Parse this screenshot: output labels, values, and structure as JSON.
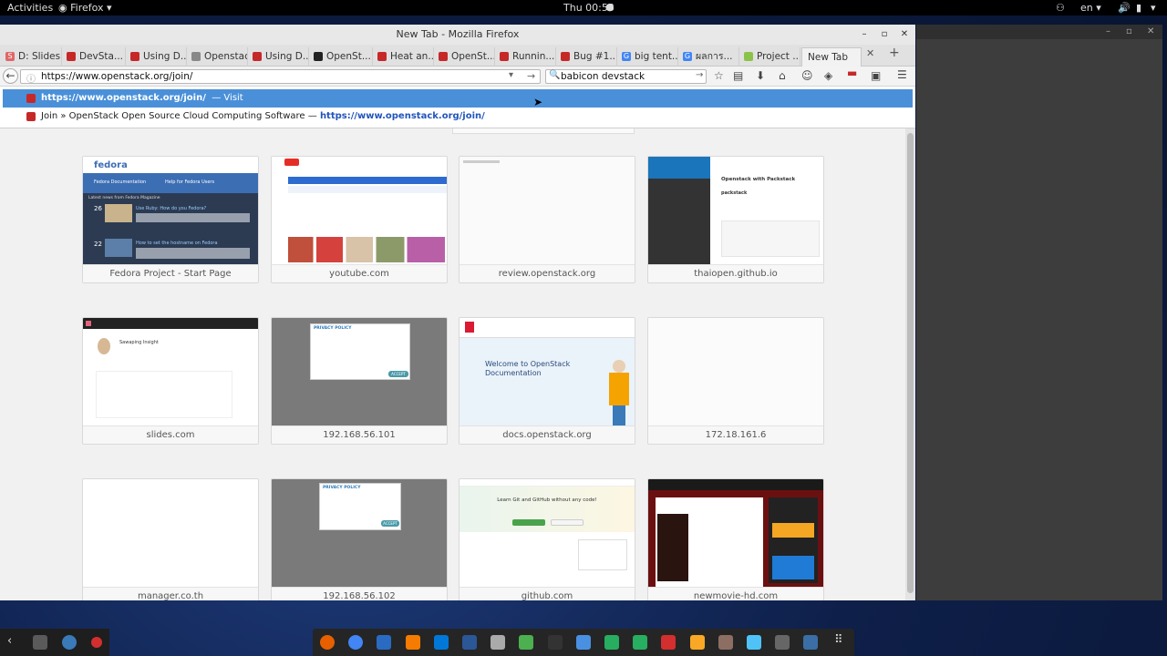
{
  "topbar": {
    "activities": "Activities",
    "app": "Firefox",
    "clock": "Thu 00:53",
    "lang": "en"
  },
  "window": {
    "title": "New Tab - Mozilla Firefox"
  },
  "tabs": [
    {
      "label": "D: Slides",
      "fav": "S",
      "color": "#e06767"
    },
    {
      "label": "DevSta...",
      "fav": "",
      "color": "#c62828"
    },
    {
      "label": "Using D...",
      "fav": "",
      "color": "#c62828"
    },
    {
      "label": "Openstack ...",
      "fav": "",
      "color": "#888888"
    },
    {
      "label": "Using D...",
      "fav": "",
      "color": "#c62828"
    },
    {
      "label": "OpenSt...",
      "fav": "",
      "color": "#222222"
    },
    {
      "label": "Heat an...",
      "fav": "",
      "color": "#c62828"
    },
    {
      "label": "OpenSt...",
      "fav": "",
      "color": "#c62828"
    },
    {
      "label": "Runnin...",
      "fav": "",
      "color": "#c62828"
    },
    {
      "label": "Bug #1...",
      "fav": "",
      "color": "#c62828"
    },
    {
      "label": "big tent...",
      "fav": "G",
      "color": "#4285f4"
    },
    {
      "label": "ผลการ...",
      "fav": "G",
      "color": "#4285f4"
    },
    {
      "label": "Project ...",
      "fav": "",
      "color": "#8bc34a"
    },
    {
      "label": "New Tab",
      "fav": "",
      "color": ""
    }
  ],
  "navbar": {
    "url": "https://www.openstack.org/join/",
    "search": "babicon devstack"
  },
  "popup": {
    "row1_url": "https://www.openstack.org/join/",
    "row1_action": "— Visit",
    "row2_title": "Join » OpenStack Open Source Cloud Computing Software",
    "row2_sep": "—",
    "row2_url": "https://www.openstack.org/join/"
  },
  "tiles": [
    {
      "caption": "Fedora Project - Start Page"
    },
    {
      "caption": "youtube.com"
    },
    {
      "caption": "review.openstack.org"
    },
    {
      "caption": "thaiopen.github.io"
    },
    {
      "caption": "slides.com"
    },
    {
      "caption": "192.168.56.101"
    },
    {
      "caption": "docs.openstack.org"
    },
    {
      "caption": "172.18.161.6"
    },
    {
      "caption": "manager.co.th"
    },
    {
      "caption": "192.168.56.102"
    },
    {
      "caption": "github.com"
    },
    {
      "caption": "newmovie-hd.com"
    }
  ],
  "thumbs": {
    "fedora": {
      "logo": "fedora",
      "doc": "Fedora Documentation",
      "help": "Help for Fedora Users",
      "latest": "Latest news from Fedora Magazine",
      "post1": "Use Ruby: How do you Fedora?",
      "post2": "How to set the hostname on Fedora",
      "d1": "26",
      "d2": "22"
    },
    "thai": {
      "title": "Openstack with Packstack",
      "sub": "packstack"
    },
    "docs": {
      "welcome": "Welcome to OpenStack Documentation"
    },
    "github": {
      "heading": "Learn Git and GitHub without any code!"
    },
    "slides": {
      "name": "Sawaping Insight"
    },
    "privacy": "PRIVACY POLICY",
    "accept": "ACCEPT"
  }
}
